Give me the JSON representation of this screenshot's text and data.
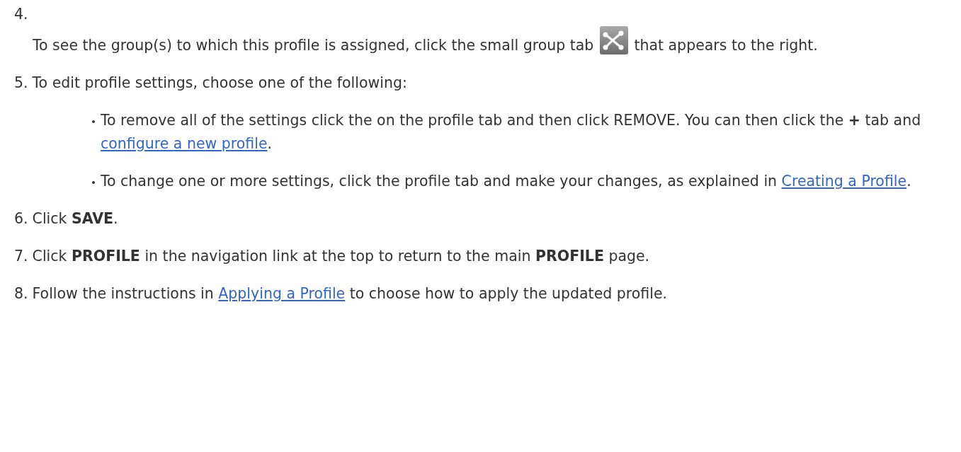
{
  "steps": [
    {
      "number": "4.",
      "kind": "stacked",
      "parts": [
        {
          "kind": "text",
          "text": "To see the group(s) to which this profile is assigned, click the small group tab "
        },
        {
          "kind": "icon"
        },
        {
          "kind": "text",
          "text": " that appears to the right."
        }
      ]
    },
    {
      "number": "5.",
      "kind": "inline",
      "parts": [
        {
          "kind": "text",
          "text": "To edit profile settings, choose one of the following:"
        }
      ],
      "bullets": [
        [
          {
            "kind": "text",
            "text": "To remove all of the settings click the on the profile tab and then click REMOVE. You can then click the **+** tab and "
          },
          {
            "kind": "link",
            "text": "configure a new profile"
          },
          {
            "kind": "text",
            "text": "."
          }
        ],
        [
          {
            "kind": "text",
            "text": "To change one or more settings, click the profile tab and make your changes, as explained in "
          },
          {
            "kind": "link",
            "text": "Creating a Profile"
          },
          {
            "kind": "text",
            "text": "."
          }
        ]
      ]
    },
    {
      "number": "6.",
      "kind": "inline",
      "parts": [
        {
          "kind": "text",
          "text": "Click **SAVE**."
        }
      ]
    },
    {
      "number": "7.",
      "kind": "inline",
      "parts": [
        {
          "kind": "text",
          "text": "Click **PROFILE** in the navigation link at the top to return to the main **PROFILE** page."
        }
      ]
    },
    {
      "number": "8.",
      "kind": "inline",
      "parts": [
        {
          "kind": "text",
          "text": "Follow the instructions in "
        },
        {
          "kind": "link",
          "text": "Applying a Profile"
        },
        {
          "kind": "text",
          "text": " to choose how to apply the updated profile."
        }
      ]
    }
  ]
}
